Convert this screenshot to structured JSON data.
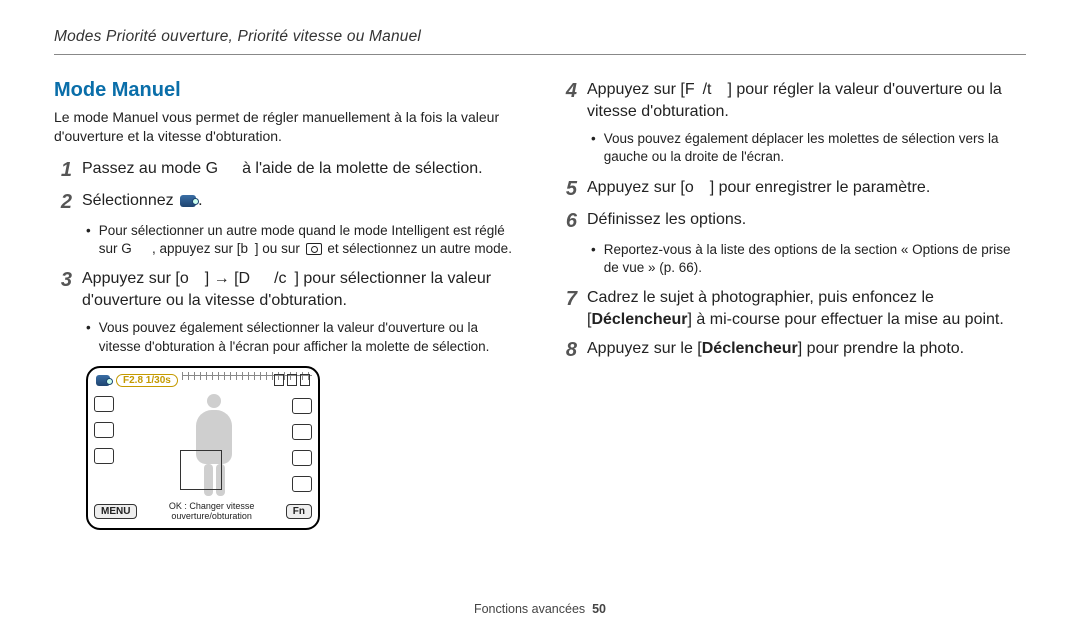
{
  "header": "Modes Priorité ouverture, Priorité vitesse ou Manuel",
  "title": "Mode Manuel",
  "intro": "Le mode Manuel vous permet de régler manuellement à la fois la valeur d'ouverture et la vitesse d'obturation.",
  "left": {
    "s1": "Passez au mode G  à l'aide de la molette de sélection.",
    "s2_pre": "Sélectionnez ",
    "s2_post": ".",
    "s2_sub_a": "Pour sélectionner un autre mode quand le mode Intelligent est réglé sur G  , appuyez sur [b ] ou sur ",
    "s2_sub_b": " et sélectionnez un autre mode.",
    "s3": "Appuyez sur [o ] → [D  /c ] pour sélectionner la valeur d'ouverture ou la vitesse d'obturation.",
    "s3_sub": "Vous pouvez également sélectionner la valeur d'ouverture ou la vitesse d'obturation à l'écran pour afficher la molette de sélection."
  },
  "right": {
    "s4": "Appuyez sur [F /t ] pour régler la valeur d'ouverture ou la vitesse d'obturation.",
    "s4_sub": "Vous pouvez également déplacer les molettes de sélection vers la gauche ou la droite de l'écran.",
    "s5": "Appuyez sur [o ] pour enregistrer le paramètre.",
    "s6": "Définissez les options.",
    "s6_sub": "Reportez-vous à la liste des options de la section « Options de prise de vue » (p. 66).",
    "s7_a": "Cadrez le sujet à photographier, puis enfoncez le [",
    "s7_bold": "Déclencheur",
    "s7_b": "] à mi-course pour effectuer la mise au point.",
    "s8_a": "Appuyez sur le [",
    "s8_bold": "Déclencheur",
    "s8_b": "] pour prendre la photo."
  },
  "figure": {
    "chip": "F2.8 1/30s",
    "menu": "MENU",
    "fn": "Fn",
    "caption": "OK : Changer vitesse ouverture/obturation"
  },
  "footer_label": "Fonctions avancées",
  "footer_page": "50",
  "nums": {
    "n1": "1",
    "n2": "2",
    "n3": "3",
    "n4": "4",
    "n5": "5",
    "n6": "6",
    "n7": "7",
    "n8": "8"
  }
}
